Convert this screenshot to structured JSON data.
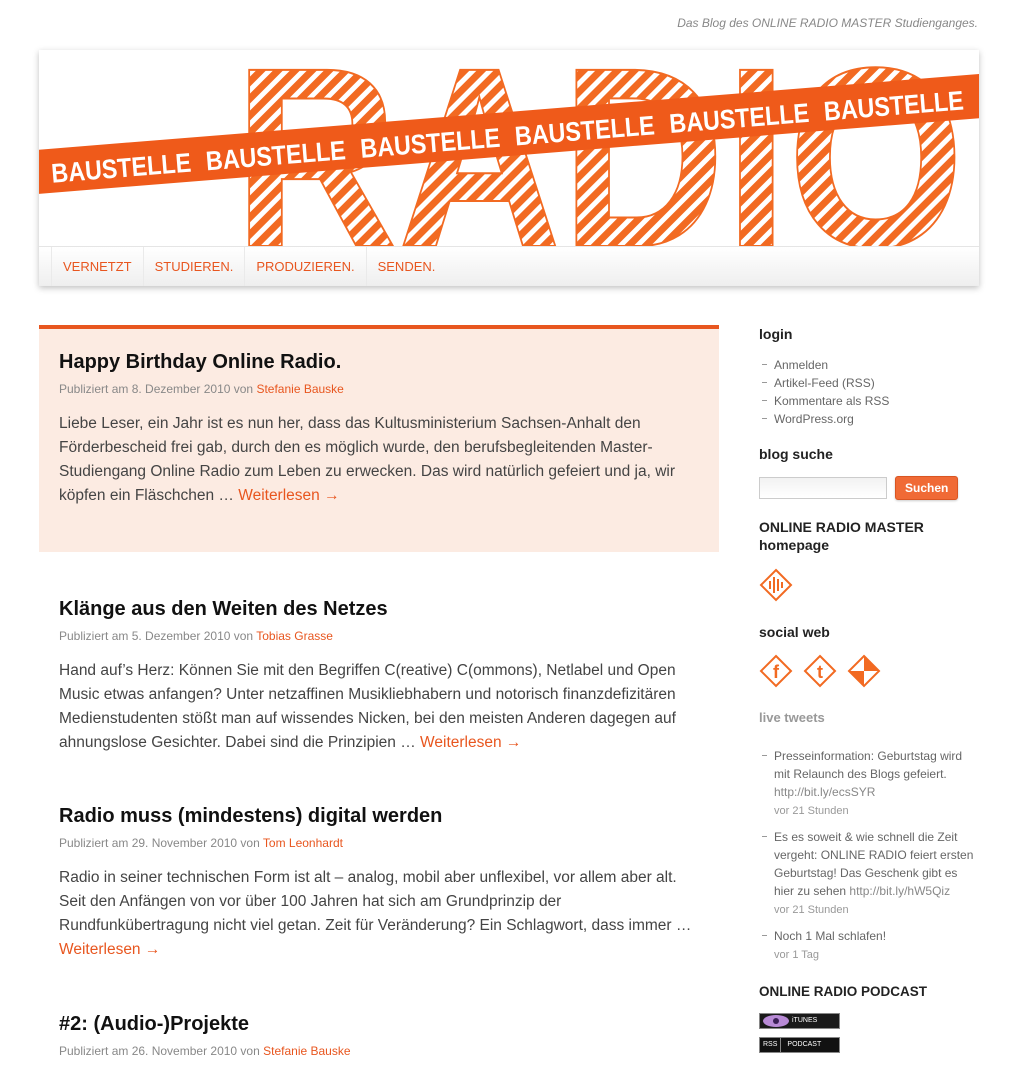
{
  "site": {
    "tagline": "Das Blog des ONLINE RADIO MASTER Studienganges.",
    "logo_text": "RADIO",
    "banner_text": "BAUSTELLE",
    "accent_color": "#e8561f"
  },
  "nav": {
    "items": [
      {
        "label": "VERNETZT"
      },
      {
        "label": "STUDIEREN."
      },
      {
        "label": "PRODUZIEREN."
      },
      {
        "label": "SENDEN."
      }
    ]
  },
  "posts": [
    {
      "title": "Happy Birthday Online Radio.",
      "meta_prefix": "Publiziert am 8. Dezember 2010 von",
      "author": "Stefanie Bauske",
      "excerpt": "Liebe Leser, ein Jahr ist es nun her, dass das Kultusministerium Sachsen-Anhalt den Förderbescheid frei gab, durch den es möglich wurde, den berufsbegleitenden Master-Studiengang Online Radio zum Leben zu erwecken. Das wird natürlich gefeiert und ja, wir köpfen ein Fläschchen …",
      "read_more": "Weiterlesen →"
    },
    {
      "title": "Klänge aus den Weiten des Netzes",
      "meta_prefix": "Publiziert am 5. Dezember 2010 von",
      "author": "Tobias Grasse",
      "excerpt": "Hand auf’s Herz: Können Sie mit den Begriffen C(reative) C(ommons), Netlabel und Open Music etwas anfangen? Unter netzaffinen Musikliebhabern und notorisch finanzdefizitären Medienstudenten stößt man auf wissendes Nicken, bei den meisten Anderen dagegen auf ahnungslose Gesichter. Dabei sind die Prinzipien …",
      "read_more": "Weiterlesen →"
    },
    {
      "title": "Radio muss (mindestens) digital werden",
      "meta_prefix": "Publiziert am 29. November 2010 von",
      "author": "Tom Leonhardt",
      "excerpt": "Radio in seiner technischen Form ist alt – analog, mobil aber unflexibel, vor allem aber alt. Seit den Anfängen von vor über 100 Jahren hat sich am Grundprinzip der Rundfunkübertragung nicht viel getan. Zeit für Veränderung? Ein Schlagwort, dass immer …",
      "read_more": "Weiterlesen →"
    },
    {
      "title": "#2: (Audio-)Projekte",
      "meta_prefix": "Publiziert am 26. November 2010 von",
      "author": "Stefanie Bauske",
      "excerpt": "",
      "read_more": ""
    }
  ],
  "sidebar": {
    "login": {
      "title": "login",
      "items": [
        {
          "label": "Anmelden"
        },
        {
          "label": "Artikel-Feed (RSS)"
        },
        {
          "label": "Kommentare als RSS"
        },
        {
          "label": "WordPress.org"
        }
      ]
    },
    "search": {
      "title": "blog suche",
      "placeholder": "",
      "button_label": "Suchen"
    },
    "homepage": {
      "title": "ONLINE RADIO MASTER homepage",
      "icon": "radio-master-icon"
    },
    "social": {
      "title": "social web",
      "icons": [
        "facebook-icon",
        "twitter-icon",
        "social-web-icon"
      ]
    },
    "tweets": {
      "title": "live tweets",
      "items": [
        {
          "text": "Presseinformation: Geburtstag wird mit Relaunch des Blogs gefeiert.",
          "link": "http://bit.ly/ecsSYR",
          "time": "vor 21 Stunden"
        },
        {
          "text": "Es es soweit & wie schnell die Zeit vergeht: ONLINE RADIO feiert ersten Geburtstag! Das Geschenk gibt es hier zu sehen",
          "link": "http://bit.ly/hW5Qiz",
          "time": "vor 21 Stunden"
        },
        {
          "text": "Noch 1 Mal schlafen!",
          "link": "",
          "time": "vor 1 Tag"
        }
      ]
    },
    "podcast": {
      "title": "ONLINE RADIO PODCAST",
      "itunes_label": "iTUNES",
      "rss_prefix": "RSS",
      "rss_label": "PODCAST"
    }
  }
}
